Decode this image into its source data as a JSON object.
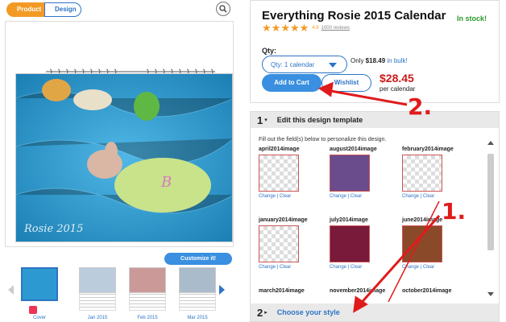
{
  "left": {
    "tabs": [
      "Product",
      "Design"
    ],
    "photo_logo": "Rosie 2015",
    "customize_label": "Customize it!",
    "thumbnails": [
      {
        "label": "Cover"
      },
      {
        "label": "Jan 2015"
      },
      {
        "label": "Feb 2015"
      },
      {
        "label": "Mar 2015"
      }
    ]
  },
  "product": {
    "title": "Everything Rosie 2015 Calendar",
    "stock": "In stock!",
    "rating": "4.9",
    "reviews": "1000 reviews",
    "qty_label": "Qty:",
    "qty_value": "Qty: 1 calendar",
    "bulk_prefix": "Only ",
    "bulk_price": "$18.49",
    "bulk_suffix": " in bulk!",
    "add_to_cart": "Add to Cart",
    "wishlist": "Wishlist",
    "price": "$28.45",
    "per": "per calendar"
  },
  "editor": {
    "step1_num": "1",
    "step1_title": "Edit this design template",
    "instructions": "Fill out the field(s) below to personalize this design.",
    "fields": [
      {
        "name": "april2014image",
        "links": "Change | Clear"
      },
      {
        "name": "august2014image",
        "links": "Change | Clear"
      },
      {
        "name": "february2014image",
        "links": "Change | Clear"
      },
      {
        "name": "january2014image",
        "links": "Change | Clear"
      },
      {
        "name": "july2014image",
        "links": "Change | Clear"
      },
      {
        "name": "june2014image",
        "links": "Change | Clear"
      },
      {
        "name": "march2014image",
        "links": ""
      },
      {
        "name": "november2014image",
        "links": ""
      },
      {
        "name": "october2014image",
        "links": ""
      }
    ],
    "step2_num": "2",
    "step2_title": "Choose your style"
  },
  "annotations": {
    "one": "1.",
    "two": "2."
  },
  "colors": {
    "accent_blue": "#2c74c6",
    "orange": "#f39a25",
    "price_red": "#cc1a1a",
    "stock_green": "#2a9a2a",
    "annotation_red": "#e01b1b"
  }
}
